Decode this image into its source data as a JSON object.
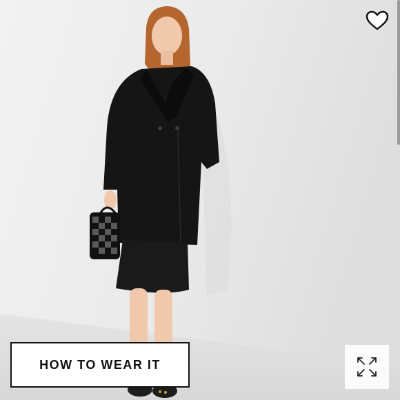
{
  "product_gallery": {
    "how_to_wear_button": {
      "label": "HOW TO WEAR IT"
    },
    "favorite_button": {
      "icon": "heart-outline-icon",
      "color": "#ffffff"
    },
    "expand_button": {
      "icon": "expand-arrows-icon",
      "color": "#222222"
    },
    "photo": {
      "subject": "model-wearing-black-coat",
      "background_color": "#ebebeb"
    }
  }
}
